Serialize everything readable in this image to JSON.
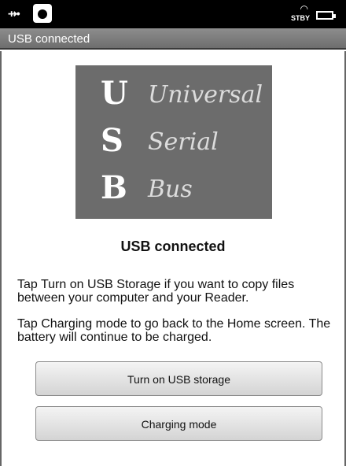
{
  "status_bar": {
    "usb_icon": "usb-icon",
    "app_icon": "app-icon",
    "wifi_icon": "wifi-icon",
    "standby_label": "STBY",
    "battery_icon": "battery-icon"
  },
  "title_bar": {
    "title": "USB connected"
  },
  "logo": {
    "rows": [
      {
        "letter": "U",
        "word": "Universal"
      },
      {
        "letter": "S",
        "word": "Serial"
      },
      {
        "letter": "B",
        "word": "Bus"
      }
    ]
  },
  "main": {
    "heading": "USB connected",
    "paragraph1": "Tap Turn on USB Storage if you want to copy files between your computer and your Reader.",
    "paragraph2": "Tap Charging mode to go back to the Home screen. The battery will continue to be charged.",
    "button_usb_storage": "Turn on USB storage",
    "button_charging_mode": "Charging mode"
  }
}
